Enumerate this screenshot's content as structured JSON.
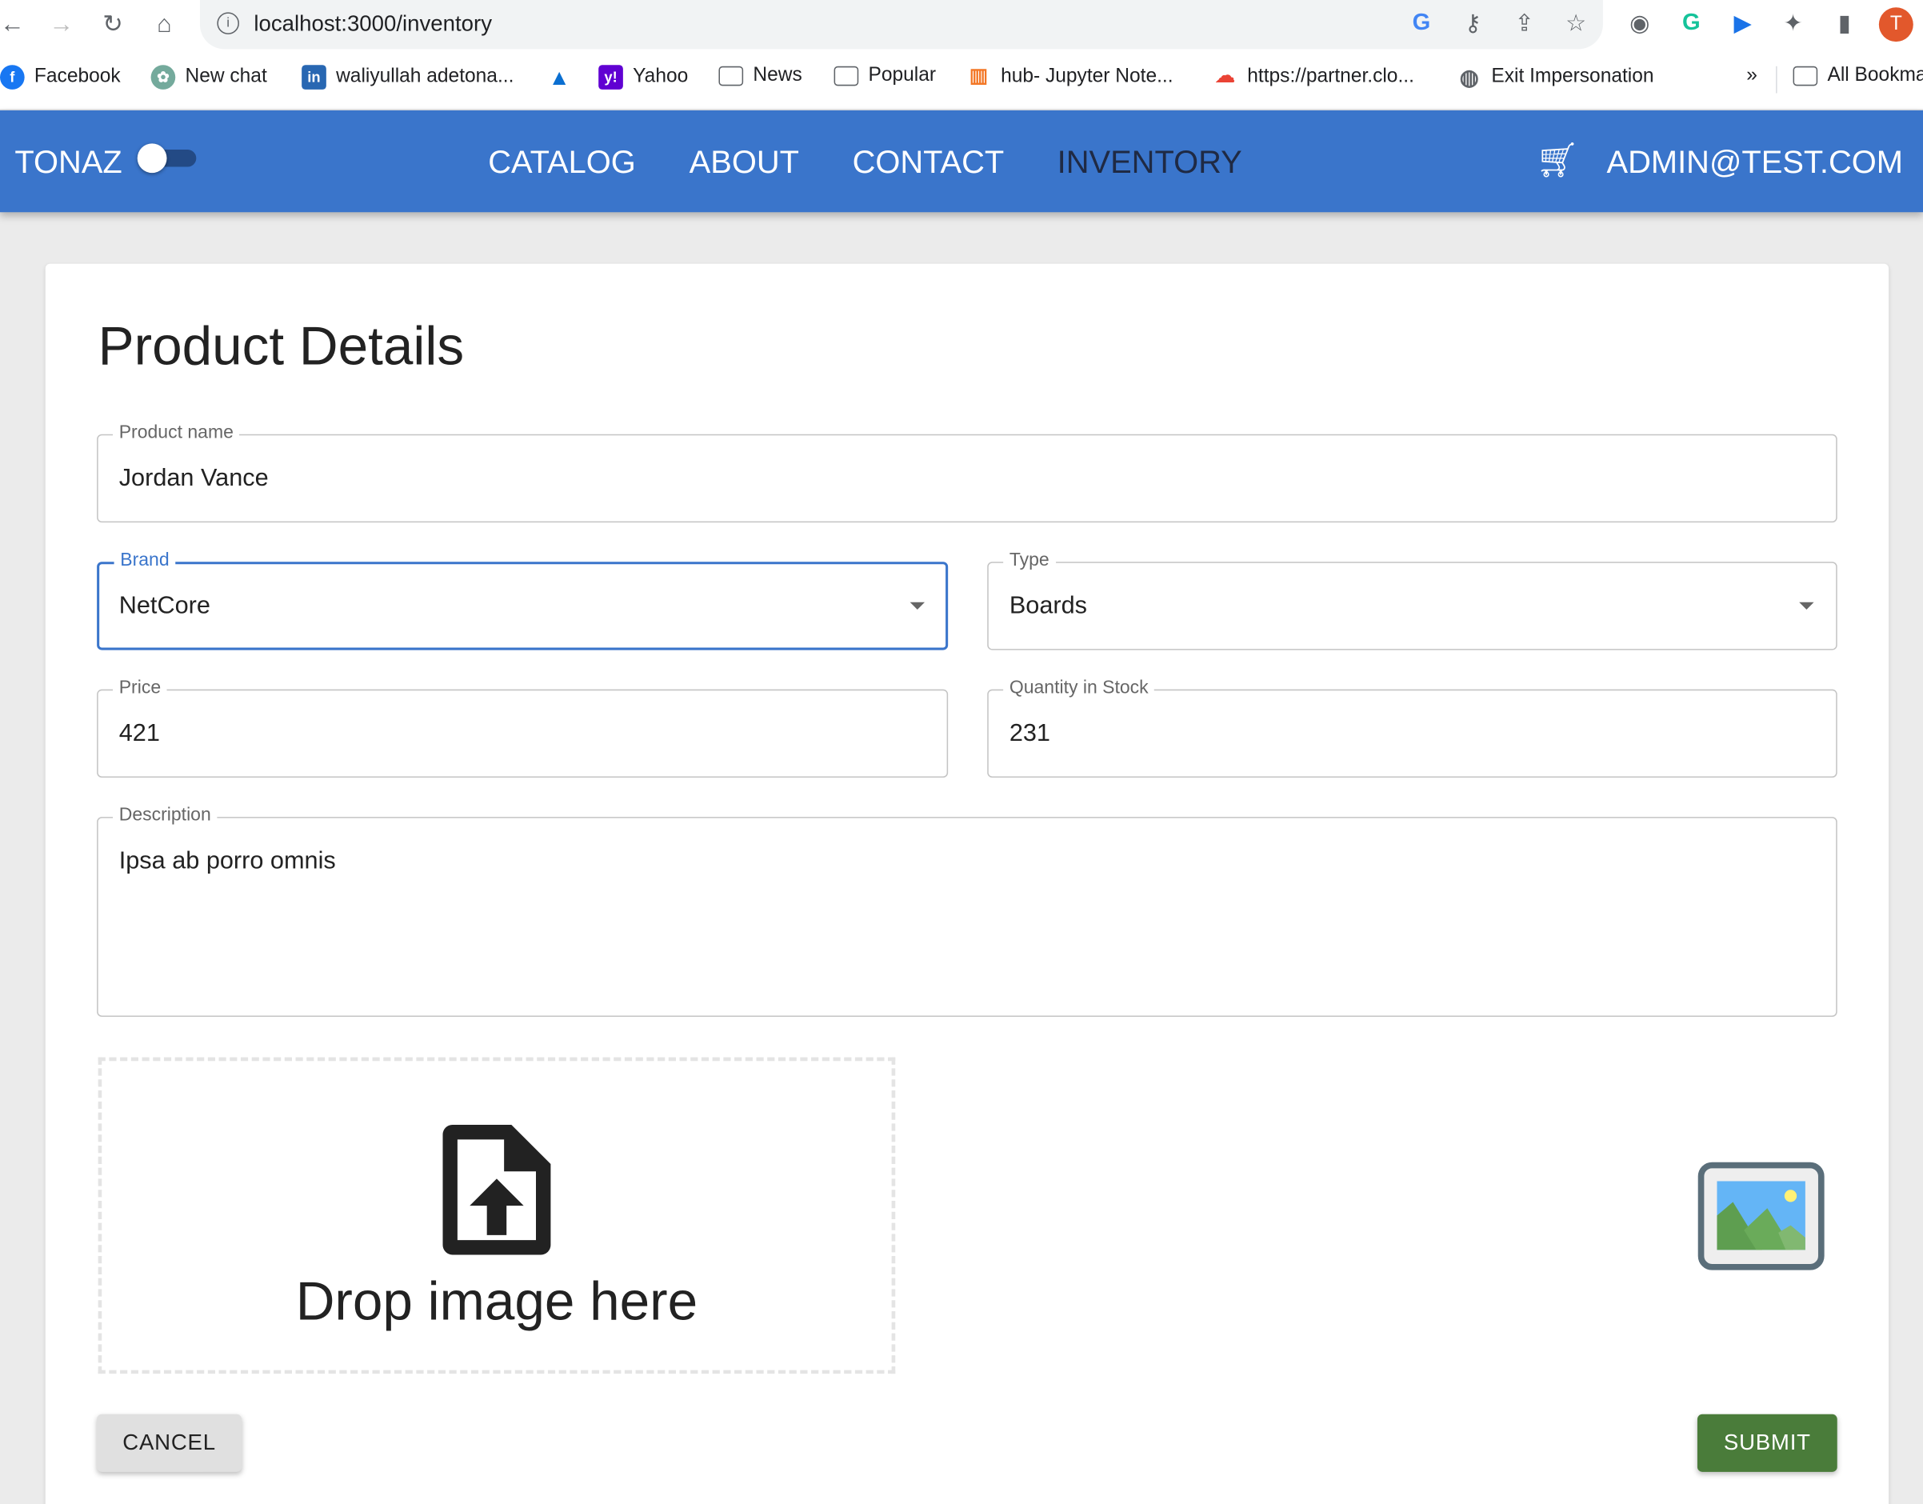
{
  "browser": {
    "url": "localhost:3000/inventory",
    "bookmarks": [
      {
        "label": "Facebook",
        "icon": "facebook-icon"
      },
      {
        "label": "New chat",
        "icon": "chatgpt-icon"
      },
      {
        "label": "waliyullah adetona...",
        "icon": "linkedin-icon"
      },
      {
        "label": "",
        "icon": "azure-icon"
      },
      {
        "label": "Yahoo",
        "icon": "yahoo-icon"
      },
      {
        "label": "News",
        "icon": "folder-icon"
      },
      {
        "label": "Popular",
        "icon": "folder-icon"
      },
      {
        "label": "hub- Jupyter Note...",
        "icon": "jupyter-icon"
      },
      {
        "label": "https://partner.clo...",
        "icon": "google-cloud-icon"
      },
      {
        "label": "Exit Impersonation",
        "icon": "globe-icon"
      }
    ],
    "more": "»",
    "all_bookmarks": "All Bookmarks",
    "profile_initial": "T"
  },
  "nav": {
    "brand": "TONAZ",
    "links": [
      "CATALOG",
      "ABOUT",
      "CONTACT",
      "INVENTORY"
    ],
    "active": "INVENTORY",
    "user": "ADMIN@TEST.COM",
    "theme_toggle_on": false
  },
  "colors": {
    "primary": "#3a75cb",
    "submit": "#4a7c3a",
    "active_link": "#1f2a44"
  },
  "form": {
    "title": "Product Details",
    "product_name": {
      "label": "Product name",
      "value": "Jordan Vance"
    },
    "brand": {
      "label": "Brand",
      "value": "NetCore"
    },
    "type": {
      "label": "Type",
      "value": "Boards"
    },
    "price": {
      "label": "Price",
      "value": "421"
    },
    "quantity": {
      "label": "Quantity in Stock",
      "value": "231"
    },
    "description": {
      "label": "Description",
      "value": "Ipsa ab porro omnis"
    },
    "dropzone": "Drop image here",
    "cancel": "CANCEL",
    "submit": "SUBMIT"
  }
}
